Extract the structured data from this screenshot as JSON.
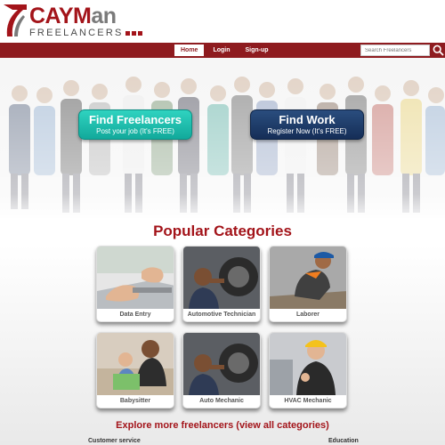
{
  "brand": {
    "name_part1": "CAYM",
    "name_part2": "an",
    "tagline": "FREELANCERS",
    "color": "#a3141a"
  },
  "nav": {
    "items": [
      {
        "label": "Home",
        "active": true
      },
      {
        "label": "Login",
        "active": false
      },
      {
        "label": "Sign-up",
        "active": false
      }
    ],
    "search_placeholder": "Search Freelancers",
    "bar_color": "#8e1b1f"
  },
  "hero": {
    "find_freelancers": {
      "title": "Find Freelancers",
      "subtitle": "Post your job (It's FREE)",
      "color": "#1bb8a8"
    },
    "find_work": {
      "title": "Find Work",
      "subtitle": "Register Now (It's FREE)",
      "color": "#1d3a66"
    }
  },
  "categories": {
    "title": "Popular Categories",
    "items": [
      {
        "label": "Data Entry"
      },
      {
        "label": "Automotive Technician"
      },
      {
        "label": "Laborer"
      },
      {
        "label": "Babysitter"
      },
      {
        "label": "Auto Mechanic"
      },
      {
        "label": "HVAC Mechanic"
      }
    ]
  },
  "explore": {
    "text": "Explore more freelancers (view all categories)"
  },
  "footer": {
    "left_heading": "Customer service",
    "right_heading": "Education"
  }
}
